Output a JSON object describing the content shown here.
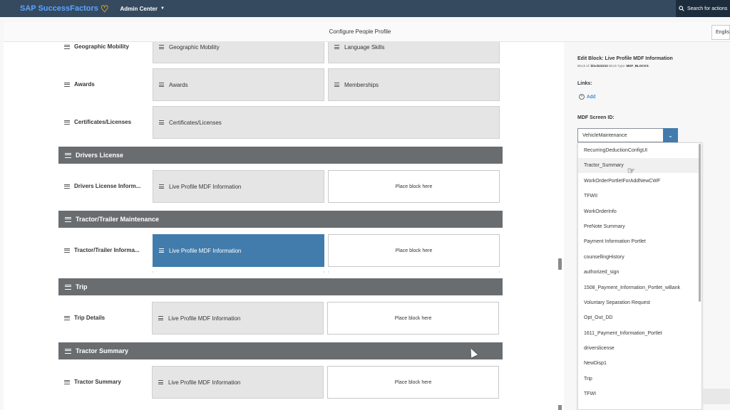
{
  "shell": {
    "brand": "SAP SuccessFactors",
    "admin_label": "Admin Center",
    "search_text": "Search for actions"
  },
  "header": {
    "title": "Configure People Profile",
    "language": "English"
  },
  "main": {
    "rows_top": [
      {
        "label": "Geographic Mobility",
        "blocks": [
          "Geographic Mobility",
          "Language Skills"
        ]
      },
      {
        "label": "Awards",
        "blocks": [
          "Awards",
          "Memberships"
        ]
      },
      {
        "label": "Certificates/Licenses",
        "blocks": [
          "Certificates/Licenses"
        ]
      }
    ],
    "sections": [
      {
        "title": "Drivers License",
        "row_label": "Drivers License Inform...",
        "block": "Live Profile MDF Information",
        "placeholder": "Place block here"
      },
      {
        "title": "Tractor/Trailer Maintenance",
        "row_label": "Tractor/Trailer Informa...",
        "block": "Live Profile MDF Information",
        "placeholder": "Place block here"
      },
      {
        "title": "Trip",
        "row_label": "Trip Details",
        "block": "Live Profile MDF Information",
        "placeholder": "Place block here"
      },
      {
        "title": "Tractor Summary",
        "row_label": "Tractor Summary",
        "block": "Live Profile MDF Information",
        "placeholder": "Place block here"
      }
    ]
  },
  "side": {
    "edit_title": "Edit Block: Live Profile MDF Information",
    "block_id_label": "Block Id:",
    "block_id": "block22210",
    "block_type_label": "Block Type:",
    "block_type": "MDF_BLOCKS",
    "links_label": "Links:",
    "add_label": "Add",
    "mdf_label": "MDF Screen ID:",
    "mdf_value": "VehicleMaintenance",
    "options": [
      "RecurringDeductionConfigUI",
      "Tractor_Summary",
      "WorkOrderPortletForAddNewCWF",
      "TFWII",
      "WorkOrderInfo",
      "PreNote Summary",
      "Payment Information Portlet",
      "counsellingHistory",
      "authorized_sign",
      "1508_Payment_Information_Portlet_wBank",
      "Voluntary Separation Request",
      "Opt_Out_DD",
      "1611_Payment_Information_Portlet",
      "driverslicense",
      "NewDisp1",
      "Trip",
      "TFWI"
    ]
  }
}
